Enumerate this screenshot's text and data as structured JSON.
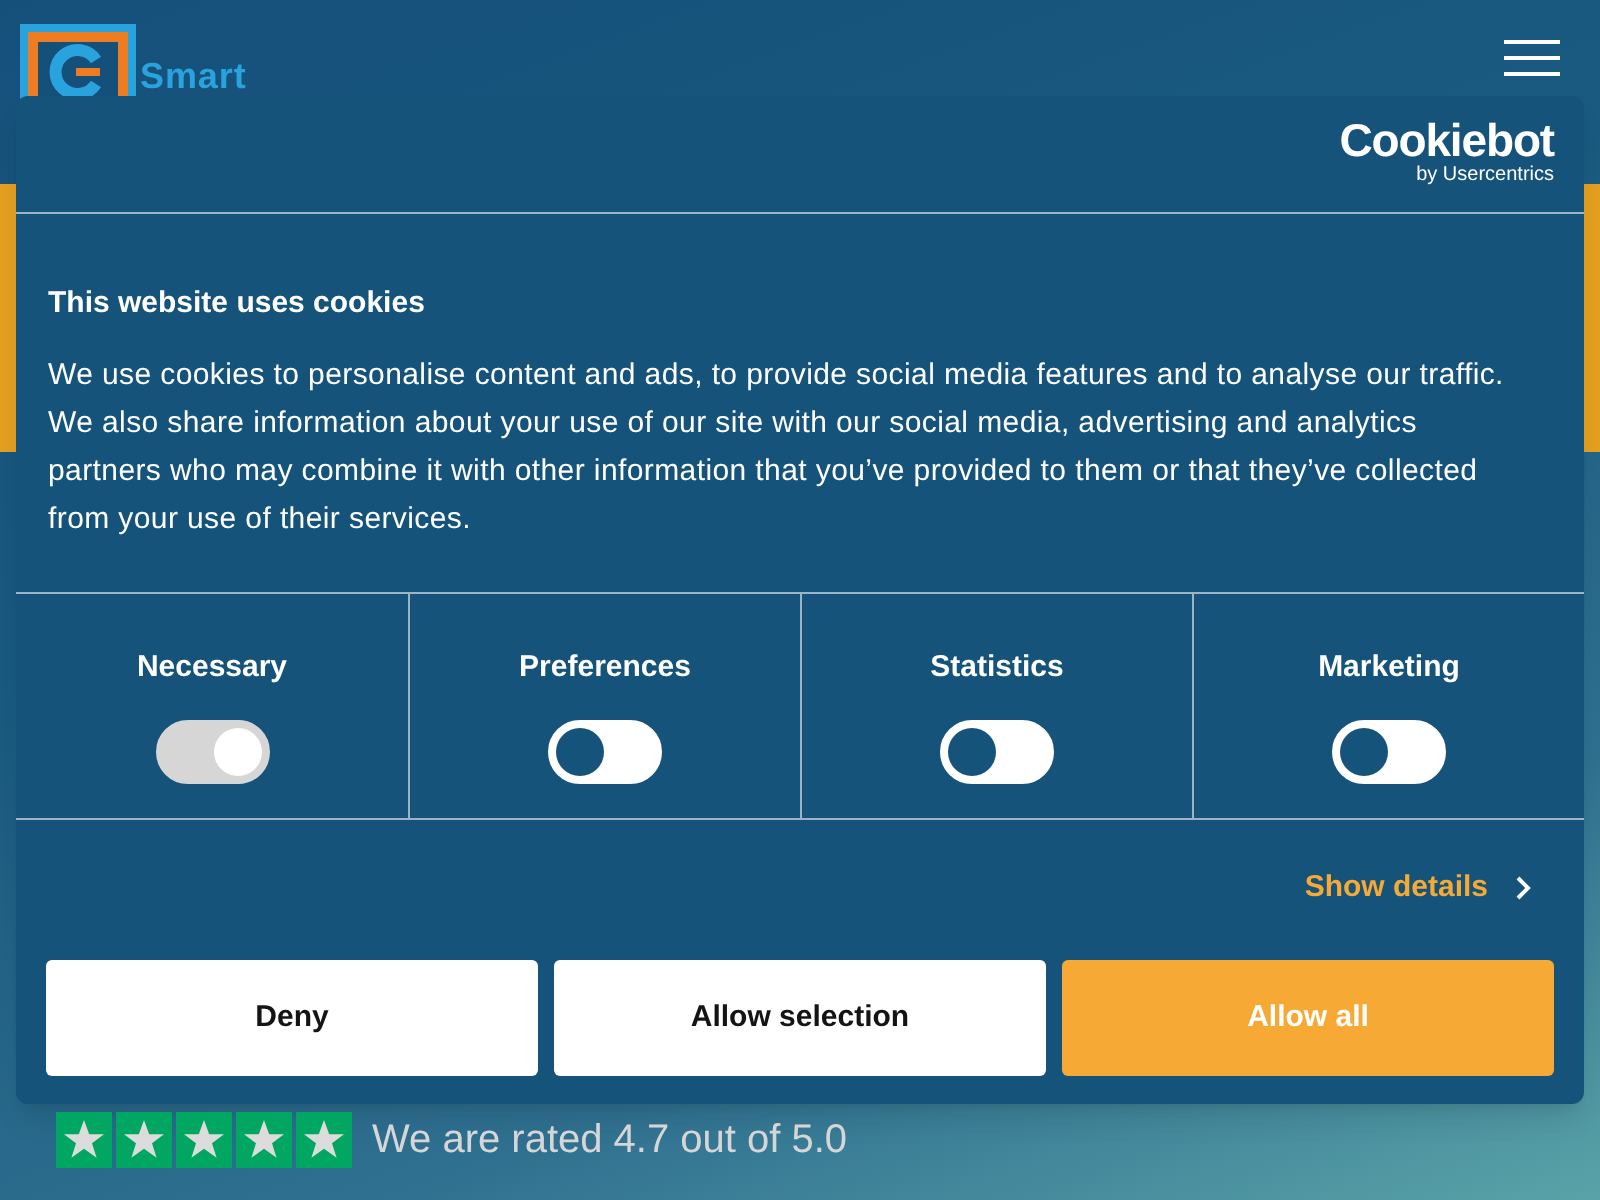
{
  "header": {
    "brand": "Smart"
  },
  "dialog": {
    "logo": {
      "name": "Cookiebot",
      "byline": "by Usercentrics"
    },
    "title": "This website uses cookies",
    "body": "We use cookies to personalise content and ads, to provide social media features and to analyse our traffic. We also share information about your use of our site with our social media, advertising and analytics partners who may combine it with other information that you’ve provided to them or that they’ve collected from your use of their services.",
    "categories": [
      {
        "label": "Necessary",
        "checked": true,
        "disabled": true
      },
      {
        "label": "Preferences",
        "checked": false,
        "disabled": false
      },
      {
        "label": "Statistics",
        "checked": false,
        "disabled": false
      },
      {
        "label": "Marketing",
        "checked": false,
        "disabled": false
      }
    ],
    "details_link": "Show details",
    "buttons": [
      {
        "label": "Deny",
        "kind": "secondary"
      },
      {
        "label": "Allow selection",
        "kind": "secondary"
      },
      {
        "label": "Allow all",
        "kind": "primary"
      }
    ]
  },
  "rating": {
    "stars": 5,
    "text": "We are rated 4.7 out of 5.0"
  }
}
